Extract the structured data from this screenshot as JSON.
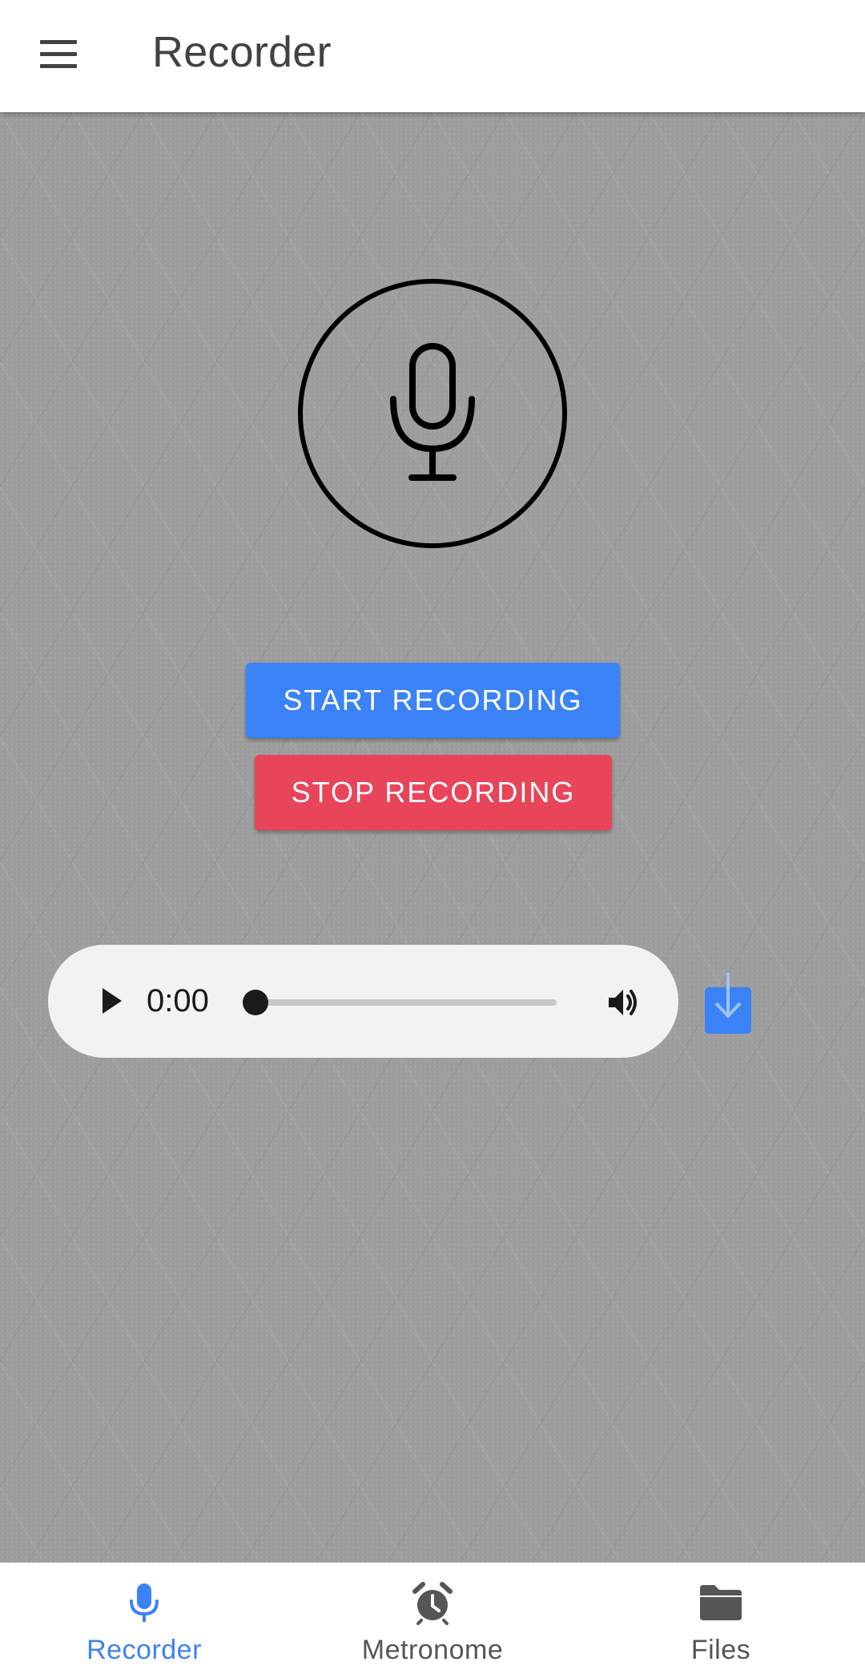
{
  "app_bar": {
    "title": "Recorder",
    "menu_icon": "menu-icon"
  },
  "recorder": {
    "mic_icon": "microphone-icon",
    "start_label": "START RECORDING",
    "stop_label": "STOP RECORDING"
  },
  "player": {
    "time": "0:00",
    "progress": 0,
    "play_icon": "play-icon",
    "volume_icon": "volume-icon",
    "download_icon": "download-icon"
  },
  "bottom_nav": {
    "items": [
      {
        "label": "Recorder",
        "icon": "microphone-icon",
        "active": true
      },
      {
        "label": "Metronome",
        "icon": "alarm-clock-icon",
        "active": false
      },
      {
        "label": "Files",
        "icon": "folder-icon",
        "active": false
      }
    ]
  },
  "colors": {
    "accent": "#3b82f6",
    "start_button": "#3b82f6",
    "stop_button": "#e8445a",
    "background": "#9e9e9e"
  }
}
